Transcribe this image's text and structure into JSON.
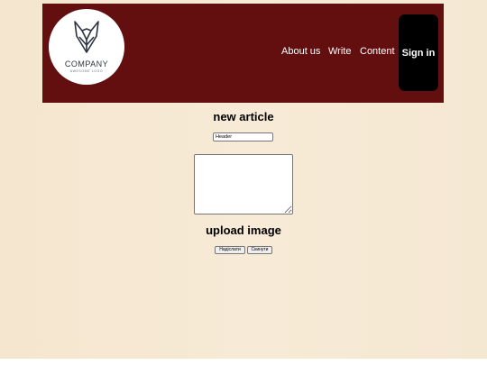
{
  "logo": {
    "text": "COMPANY",
    "tagline": "AWESOME LOGO",
    "icon": "fox-icon"
  },
  "nav": {
    "about": "About us",
    "write": "Write",
    "content": "Content",
    "signin": "Sign in"
  },
  "form": {
    "title": "new article",
    "header_value": "Header",
    "body_value": "",
    "upload_title": "upload image",
    "submit_label": "Надіслати",
    "reset_label": "Скинути"
  },
  "colors": {
    "header_bg": "#630f0f",
    "signin_bg": "#000000",
    "page_bg": "#f7ead6"
  }
}
